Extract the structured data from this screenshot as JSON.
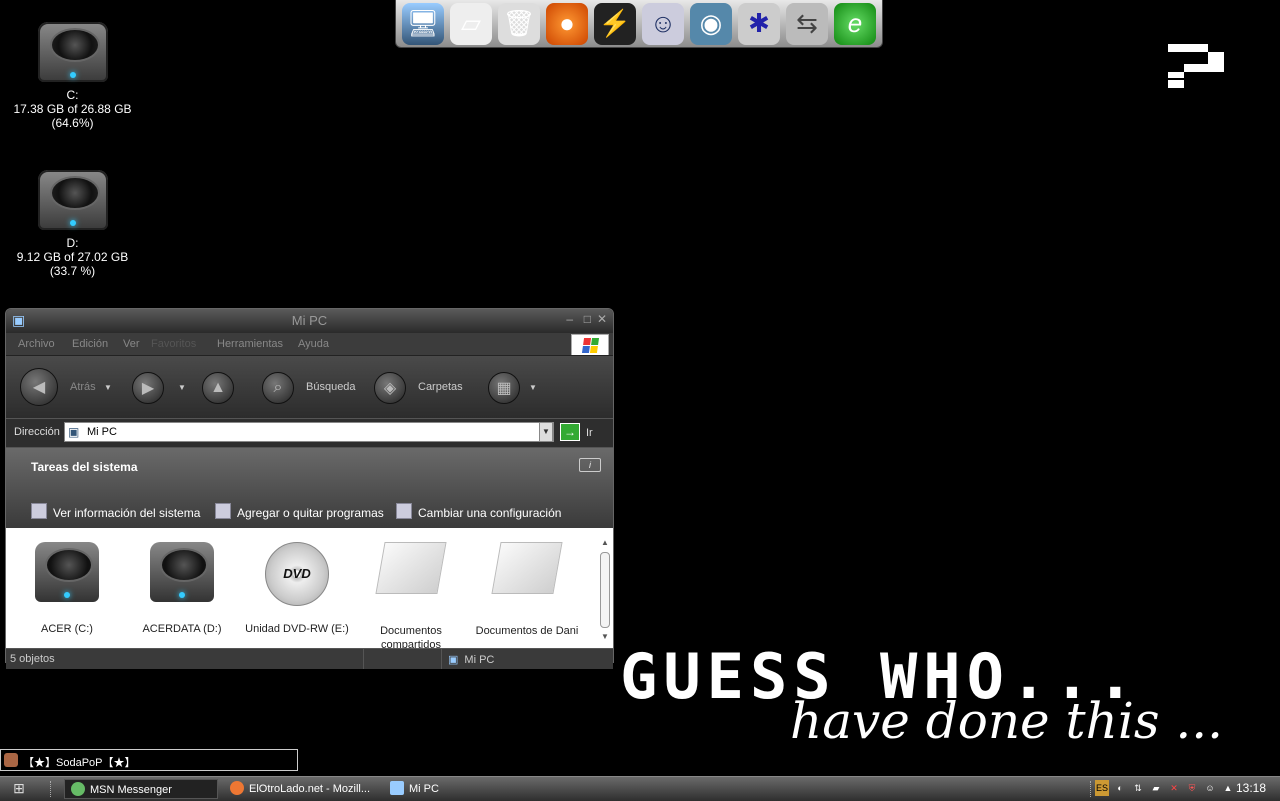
{
  "desktop": {
    "drives": [
      {
        "letter": "C:",
        "usage": "17.38 GB of 26.88 GB",
        "percent": "(64.6%)"
      },
      {
        "letter": "D:",
        "usage": "9.12 GB of 27.02 GB",
        "percent": "(33.7 %)"
      }
    ],
    "wallpaper": {
      "line1": "GUESS WHO...",
      "line2": "have done this ..."
    }
  },
  "window": {
    "title": "Mi PC",
    "menu": [
      "Archivo",
      "Edición",
      "Ver",
      "Favoritos",
      "Herramientas",
      "Ayuda"
    ],
    "toolbar": {
      "back": "Atrás",
      "search": "Búsqueda",
      "folders": "Carpetas"
    },
    "address": {
      "label": "Dirección",
      "value": "Mi PC",
      "go": "Ir"
    },
    "tasks": {
      "heading": "Tareas del sistema",
      "items": [
        "Ver información del sistema",
        "Agregar o quitar programas",
        "Cambiar una configuración"
      ]
    },
    "items": [
      {
        "label": "ACER (C:)",
        "icon": "hard-drive-icon"
      },
      {
        "label": "ACERDATA (D:)",
        "icon": "hard-drive-icon"
      },
      {
        "label": "Unidad DVD-RW (E:)",
        "icon": "dvd-icon"
      },
      {
        "label": "Documentos compartidos",
        "icon": "folder-icon"
      },
      {
        "label": "Documentos de Dani",
        "icon": "folder-icon"
      }
    ],
    "dvd_text": "DVD",
    "status": {
      "count": "5 objetos",
      "location": "Mi PC"
    }
  },
  "msn": {
    "name": "【★】SodaPoP【★】"
  },
  "taskbar": {
    "items": [
      "MSN Messenger",
      "ElOtroLado.net - Mozill...",
      "Mi PC"
    ],
    "tray_lang": "ES",
    "clock": "13:18"
  },
  "colors": {
    "accent": "#33ccff",
    "background": "#000000"
  }
}
